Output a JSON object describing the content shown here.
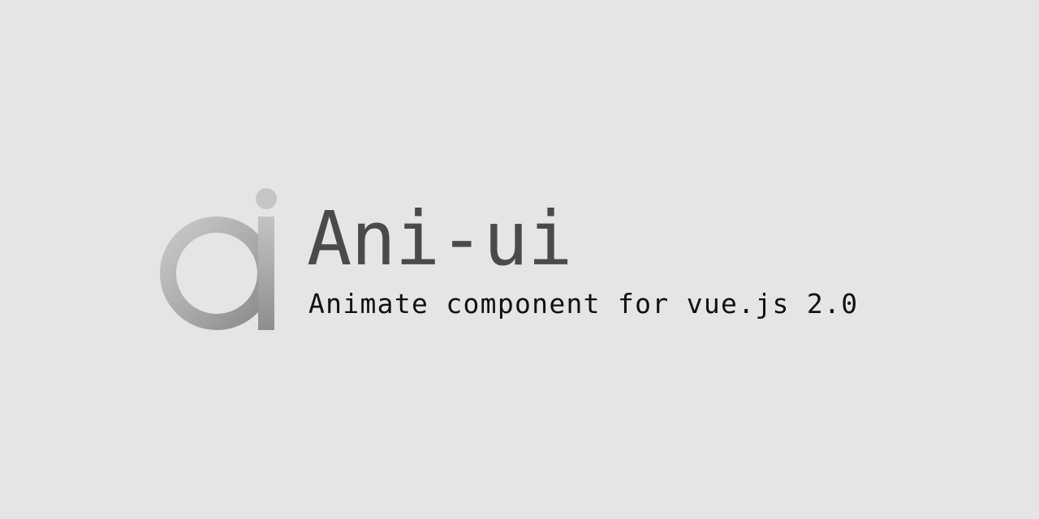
{
  "brand": {
    "title": "Ani-ui",
    "tagline": "Animate component for vue.js 2.0",
    "logo_icon": "ai-monogram-logo",
    "colors": {
      "background": "#e5e5e5",
      "title": "#4a4a4a",
      "tagline": "#111111",
      "logo_light": "#c9c9c9",
      "logo_mid": "#b0b0b0",
      "logo_dark": "#8c8c8c"
    }
  }
}
